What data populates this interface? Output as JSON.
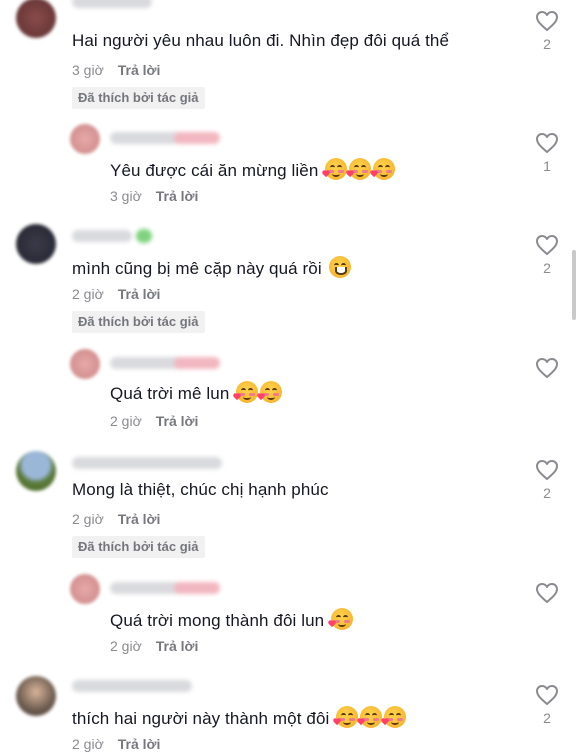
{
  "comments": [
    {
      "text": "Hai người yêu nhau luôn đi. Nhìn đẹp đôi quá thể",
      "time": "3 giờ",
      "reply": "Trả lời",
      "badge": "Đã thích bởi tác giả",
      "likes": "2"
    },
    {
      "text": "Yêu được cái ăn mừng liền",
      "time": "3 giờ",
      "reply": "Trả lời",
      "likes": "1",
      "emoji": [
        "smiling-face-with-hearts",
        "smiling-face-with-hearts",
        "smiling-face-with-hearts"
      ]
    },
    {
      "text": "mình cũng bị mê cặp này quá rồi",
      "time": "2 giờ",
      "reply": "Trả lời",
      "badge": "Đã thích bởi tác giả",
      "likes": "2",
      "emoji": [
        "grinning-face"
      ]
    },
    {
      "text": "Quá trời mê lun",
      "time": "2 giờ",
      "reply": "Trả lời",
      "likes": "",
      "emoji": [
        "smiling-face-with-hearts",
        "smiling-face-with-hearts"
      ]
    },
    {
      "text": "Mong là thiệt, chúc chị hạnh phúc",
      "time": "2 giờ",
      "reply": "Trả lời",
      "badge": "Đã thích bởi tác giả",
      "likes": "2"
    },
    {
      "text": "Quá trời mong thành đôi lun",
      "time": "2 giờ",
      "reply": "Trả lời",
      "likes": "",
      "emoji": [
        "smiling-face-with-hearts"
      ]
    },
    {
      "text": "thích hai người này thành một đôi",
      "time": "2 giờ",
      "reply": "Trả lời",
      "likes": "2",
      "emoji": [
        "smiling-face-with-hearts",
        "smiling-face-with-hearts",
        "smiling-face-with-hearts"
      ]
    }
  ],
  "colors": {
    "text": "#161823",
    "muted": "#8a8b91",
    "badge_bg": "#f1f1f2",
    "heart_outline": "#8a8b91"
  },
  "icons": {
    "like": "heart-outline-icon"
  }
}
